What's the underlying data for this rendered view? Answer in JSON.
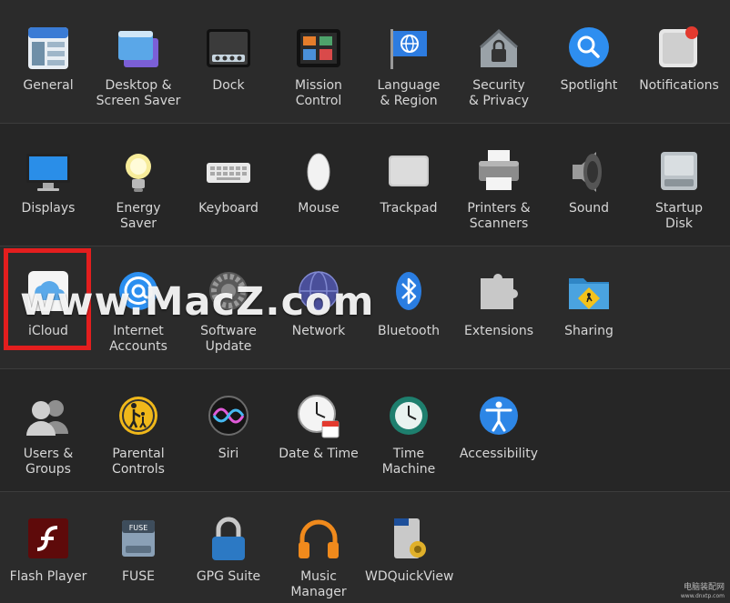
{
  "rows": [
    [
      {
        "id": "general",
        "label": "General",
        "icon": "general-icon"
      },
      {
        "id": "desktop",
        "label": "Desktop &\nScreen Saver",
        "icon": "desktop-icon"
      },
      {
        "id": "dock",
        "label": "Dock",
        "icon": "dock-icon"
      },
      {
        "id": "mission",
        "label": "Mission\nControl",
        "icon": "mission-control-icon"
      },
      {
        "id": "language",
        "label": "Language\n& Region",
        "icon": "flag-globe-icon"
      },
      {
        "id": "security",
        "label": "Security\n& Privacy",
        "icon": "house-lock-icon"
      },
      {
        "id": "spotlight",
        "label": "Spotlight",
        "icon": "spotlight-icon"
      },
      {
        "id": "notifications",
        "label": "Notifications",
        "icon": "notifications-icon"
      }
    ],
    [
      {
        "id": "displays",
        "label": "Displays",
        "icon": "display-icon"
      },
      {
        "id": "energy",
        "label": "Energy\nSaver",
        "icon": "lightbulb-icon"
      },
      {
        "id": "keyboard",
        "label": "Keyboard",
        "icon": "keyboard-icon"
      },
      {
        "id": "mouse",
        "label": "Mouse",
        "icon": "mouse-icon"
      },
      {
        "id": "trackpad",
        "label": "Trackpad",
        "icon": "trackpad-icon"
      },
      {
        "id": "printers",
        "label": "Printers &\nScanners",
        "icon": "printer-icon"
      },
      {
        "id": "sound",
        "label": "Sound",
        "icon": "speaker-icon"
      },
      {
        "id": "startup",
        "label": "Startup\nDisk",
        "icon": "disk-icon"
      }
    ],
    [
      {
        "id": "icloud",
        "label": "iCloud",
        "icon": "icloud-icon"
      },
      {
        "id": "internet",
        "label": "Internet\nAccounts",
        "icon": "at-icon"
      },
      {
        "id": "swupdate",
        "label": "Software\nUpdate",
        "icon": "gear-icon"
      },
      {
        "id": "network",
        "label": "Network",
        "icon": "network-globe-icon"
      },
      {
        "id": "bluetooth",
        "label": "Bluetooth",
        "icon": "bluetooth-icon"
      },
      {
        "id": "extensions",
        "label": "Extensions",
        "icon": "puzzle-icon"
      },
      {
        "id": "sharing",
        "label": "Sharing",
        "icon": "sharing-folder-icon"
      }
    ],
    [
      {
        "id": "users",
        "label": "Users &\nGroups",
        "icon": "users-icon"
      },
      {
        "id": "parental",
        "label": "Parental\nControls",
        "icon": "parental-icon"
      },
      {
        "id": "siri",
        "label": "Siri",
        "icon": "siri-icon"
      },
      {
        "id": "datetime",
        "label": "Date & Time",
        "icon": "clock-icon"
      },
      {
        "id": "timemachine",
        "label": "Time\nMachine",
        "icon": "time-machine-icon"
      },
      {
        "id": "accessibility",
        "label": "Accessibility",
        "icon": "accessibility-icon"
      }
    ],
    [
      {
        "id": "flash",
        "label": "Flash Player",
        "icon": "flash-icon"
      },
      {
        "id": "fuse",
        "label": "FUSE",
        "icon": "fuse-icon"
      },
      {
        "id": "gpg",
        "label": "GPG Suite",
        "icon": "padlock-icon"
      },
      {
        "id": "music",
        "label": "Music\nManager",
        "icon": "headphones-icon"
      },
      {
        "id": "wd",
        "label": "WDQuickView",
        "icon": "wd-drive-icon"
      }
    ]
  ],
  "watermark": "www.MacZ.com",
  "corner_mark": {
    "line1": "电脑装配网",
    "line2": "www.dnxtp.com"
  }
}
